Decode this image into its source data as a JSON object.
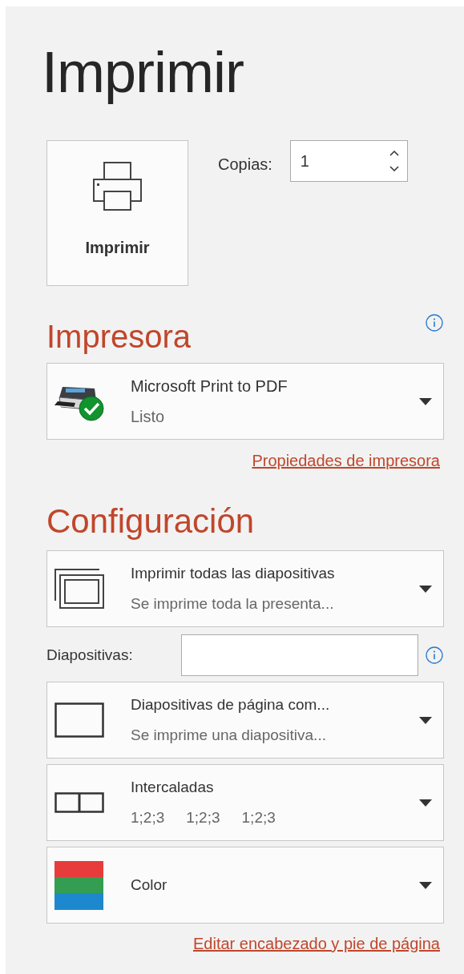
{
  "title": "Imprimir",
  "print_button": {
    "label": "Imprimir"
  },
  "copies": {
    "label": "Copias:",
    "value": "1"
  },
  "printer_section": {
    "heading": "Impresora",
    "name": "Microsoft Print to PDF",
    "status": "Listo",
    "link": "Propiedades de impresora"
  },
  "settings_section": {
    "heading": "Configuración",
    "items": [
      {
        "kind": "range",
        "title": "Imprimir todas las diapositivas",
        "subtitle": "Se imprime toda la presenta..."
      },
      {
        "kind": "field",
        "label": "Diapositivas:"
      },
      {
        "kind": "layout",
        "title": "Diapositivas de página com...",
        "subtitle": "Se imprime una diapositiva..."
      },
      {
        "kind": "collate",
        "title": "Intercaladas",
        "details": [
          "1;2;3",
          "1;2;3",
          "1;2;3"
        ]
      },
      {
        "kind": "color",
        "title": "Color"
      }
    ],
    "link": "Editar encabezado y pie de página"
  }
}
